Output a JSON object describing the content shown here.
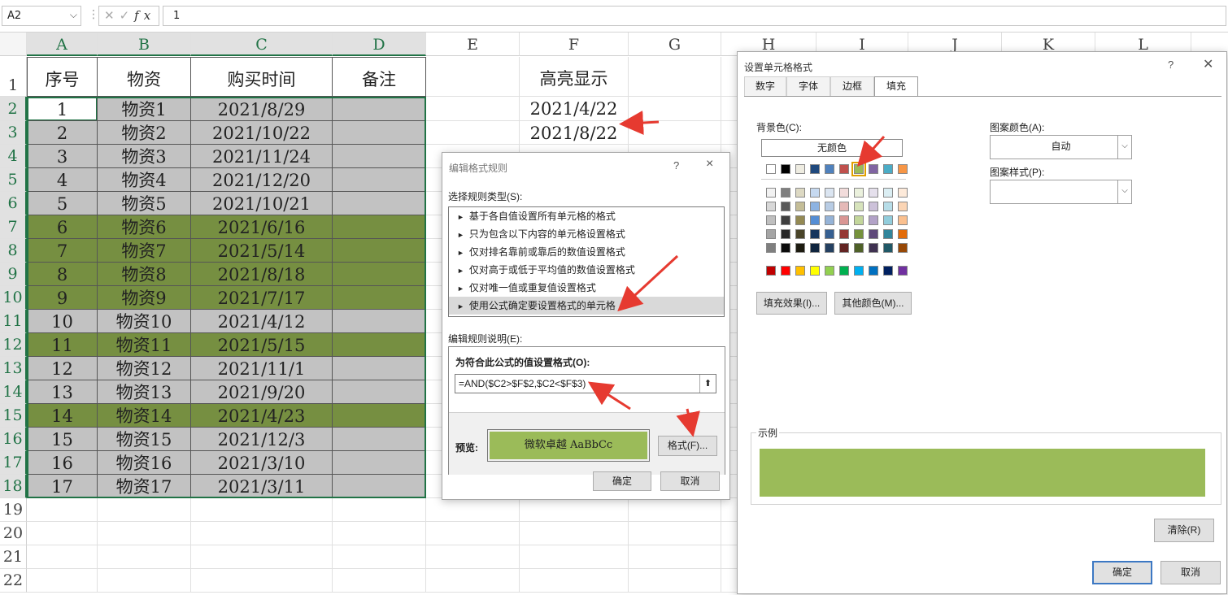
{
  "formula_bar": {
    "name_box": "A2",
    "fx": "fx",
    "formula": "1"
  },
  "columns": [
    "A",
    "B",
    "C",
    "D",
    "E",
    "F",
    "G",
    "H",
    "I",
    "J",
    "K",
    "L"
  ],
  "rows": [
    "1",
    "2",
    "3",
    "4",
    "5",
    "6",
    "7",
    "8",
    "9",
    "10",
    "11",
    "12",
    "13",
    "14",
    "15",
    "16",
    "17",
    "18",
    "19",
    "20",
    "21",
    "22"
  ],
  "table": {
    "headers": [
      "序号",
      "物资",
      "购买时间",
      "备注"
    ],
    "rows": [
      {
        "no": "1",
        "item": "物资1",
        "date": "2021/8/29",
        "note": "",
        "fill": "gray"
      },
      {
        "no": "2",
        "item": "物资2",
        "date": "2021/10/22",
        "note": "",
        "fill": "gray"
      },
      {
        "no": "3",
        "item": "物资3",
        "date": "2021/11/24",
        "note": "",
        "fill": "gray"
      },
      {
        "no": "4",
        "item": "物资4",
        "date": "2021/12/20",
        "note": "",
        "fill": "gray"
      },
      {
        "no": "5",
        "item": "物资5",
        "date": "2021/10/21",
        "note": "",
        "fill": "gray"
      },
      {
        "no": "6",
        "item": "物资6",
        "date": "2021/6/16",
        "note": "",
        "fill": "green"
      },
      {
        "no": "7",
        "item": "物资7",
        "date": "2021/5/14",
        "note": "",
        "fill": "green"
      },
      {
        "no": "8",
        "item": "物资8",
        "date": "2021/8/18",
        "note": "",
        "fill": "green"
      },
      {
        "no": "9",
        "item": "物资9",
        "date": "2021/7/17",
        "note": "",
        "fill": "green"
      },
      {
        "no": "10",
        "item": "物资10",
        "date": "2021/4/12",
        "note": "",
        "fill": "gray"
      },
      {
        "no": "11",
        "item": "物资11",
        "date": "2021/5/15",
        "note": "",
        "fill": "green"
      },
      {
        "no": "12",
        "item": "物资12",
        "date": "2021/11/1",
        "note": "",
        "fill": "gray"
      },
      {
        "no": "13",
        "item": "物资13",
        "date": "2021/9/20",
        "note": "",
        "fill": "gray"
      },
      {
        "no": "14",
        "item": "物资14",
        "date": "2021/4/23",
        "note": "",
        "fill": "green"
      },
      {
        "no": "15",
        "item": "物资15",
        "date": "2021/12/3",
        "note": "",
        "fill": "gray"
      },
      {
        "no": "16",
        "item": "物资16",
        "date": "2021/3/10",
        "note": "",
        "fill": "gray"
      },
      {
        "no": "17",
        "item": "物资17",
        "date": "2021/3/11",
        "note": "",
        "fill": "gray"
      }
    ]
  },
  "highlight": {
    "header": "高亮显示",
    "dates": [
      "2021/4/22",
      "2021/8/22"
    ]
  },
  "colors": {
    "gray_fill": "#c2c2c2",
    "green_fill": "#768f41",
    "preview_fill": "#9bbb59",
    "accent": "#217346"
  },
  "rule_dialog": {
    "title": "编辑格式规则",
    "help": "?",
    "close": "×",
    "rule_type_label": "选择规则类型(S):",
    "rule_types": [
      "基于各自值设置所有单元格的格式",
      "只为包含以下内容的单元格设置格式",
      "仅对排名靠前或靠后的数值设置格式",
      "仅对高于或低于平均值的数值设置格式",
      "仅对唯一值或重复值设置格式",
      "使用公式确定要设置格式的单元格"
    ],
    "bullet": "►",
    "desc_label": "编辑规则说明(E):",
    "formula_label": "为符合此公式的值设置格式(O):",
    "formula": "=AND($C2>$F$2,$C2<$F$3)",
    "collapse_icon": "⬆",
    "preview_label": "预览:",
    "preview_text": "微软卓越  AaBbCc",
    "format_btn": "格式(F)...",
    "ok": "确定",
    "cancel": "取消"
  },
  "format_dialog": {
    "title": "设置单元格格式",
    "help": "?",
    "close": "✕",
    "tabs": [
      "数字",
      "字体",
      "边框",
      "填充"
    ],
    "bg_label": "背景色(C):",
    "no_color": "无颜色",
    "pattern_color_label": "图案颜色(A):",
    "pattern_color": "自动",
    "pattern_style_label": "图案样式(P):",
    "fill_effects": "填充效果(I)...",
    "more_colors": "其他颜色(M)...",
    "sample_label": "示例",
    "clear": "清除(R)",
    "ok": "确定",
    "cancel": "取消",
    "theme_top": [
      "#ffffff",
      "#000000",
      "#eeece1",
      "#1f497d",
      "#4f81bd",
      "#c0504d",
      "#9bbb59",
      "#8064a2",
      "#4bacc6",
      "#f79646"
    ],
    "theme_shades": [
      [
        "#f2f2f2",
        "#7f7f7f",
        "#ddd9c3",
        "#c6d9f0",
        "#dbe5f1",
        "#f2dcdb",
        "#ebf1dd",
        "#e5e0ec",
        "#dbeef3",
        "#fdeada"
      ],
      [
        "#d8d8d8",
        "#595959",
        "#c4bd97",
        "#8db3e2",
        "#b8cce4",
        "#e5b9b7",
        "#d7e3bc",
        "#ccc1d9",
        "#b7dde8",
        "#fbd5b5"
      ],
      [
        "#bfbfbf",
        "#3f3f3f",
        "#938953",
        "#548dd4",
        "#95b3d7",
        "#d99694",
        "#c3d69b",
        "#b2a2c7",
        "#92cddc",
        "#fac08f"
      ],
      [
        "#a5a5a5",
        "#262626",
        "#494429",
        "#17365d",
        "#366092",
        "#953734",
        "#76923c",
        "#5f497a",
        "#31859b",
        "#e36c09"
      ],
      [
        "#7f7f7f",
        "#0c0c0c",
        "#1d1b10",
        "#0f243e",
        "#244061",
        "#632423",
        "#4f6128",
        "#3f3151",
        "#205867",
        "#974806"
      ]
    ],
    "standard": [
      "#c00000",
      "#ff0000",
      "#ffc000",
      "#ffff00",
      "#92d050",
      "#00b050",
      "#00b0f0",
      "#0070c0",
      "#002060",
      "#7030a0"
    ]
  }
}
